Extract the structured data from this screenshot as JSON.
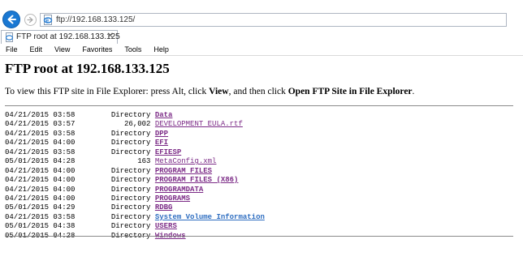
{
  "browser": {
    "address": "ftp://192.168.133.125/",
    "tab_title": "FTP root at 192.168.133.125",
    "tab_close": "✕",
    "menu": [
      "File",
      "Edit",
      "View",
      "Favorites",
      "Tools",
      "Help"
    ]
  },
  "page": {
    "title": "FTP root at 192.168.133.125",
    "instruction_before": "To view this FTP site in File Explorer: press Alt, click ",
    "instruction_view": "View",
    "instruction_middle": ", and then click ",
    "instruction_open": "Open FTP Site in File Explorer",
    "instruction_after": "."
  },
  "listing": [
    {
      "date": "04/21/2015",
      "time": "03:58",
      "info": "Directory",
      "name": "Data",
      "type": "dir"
    },
    {
      "date": "04/21/2015",
      "time": "03:57",
      "info": "26,002",
      "name": "DEVELOPMENT EULA.rtf",
      "type": "file"
    },
    {
      "date": "04/21/2015",
      "time": "03:58",
      "info": "Directory",
      "name": "DPP",
      "type": "dir"
    },
    {
      "date": "04/21/2015",
      "time": "04:00",
      "info": "Directory",
      "name": "EFI",
      "type": "dir"
    },
    {
      "date": "04/21/2015",
      "time": "03:58",
      "info": "Directory",
      "name": "EFIESP",
      "type": "dir"
    },
    {
      "date": "05/01/2015",
      "time": "04:28",
      "info": "163",
      "name": "MetaConfig.xml",
      "type": "file"
    },
    {
      "date": "04/21/2015",
      "time": "04:00",
      "info": "Directory",
      "name": "PROGRAM FILES",
      "type": "dir"
    },
    {
      "date": "04/21/2015",
      "time": "04:00",
      "info": "Directory",
      "name": "PROGRAM FILES (X86)",
      "type": "dir"
    },
    {
      "date": "04/21/2015",
      "time": "04:00",
      "info": "Directory",
      "name": "PROGRAMDATA",
      "type": "dir"
    },
    {
      "date": "04/21/2015",
      "time": "04:00",
      "info": "Directory",
      "name": "PROGRAMS",
      "type": "dir"
    },
    {
      "date": "05/01/2015",
      "time": "04:29",
      "info": "Directory",
      "name": "RDBG",
      "type": "dir"
    },
    {
      "date": "04/21/2015",
      "time": "03:58",
      "info": "Directory",
      "name": "System Volume Information",
      "type": "dir-blue"
    },
    {
      "date": "05/01/2015",
      "time": "04:38",
      "info": "Directory",
      "name": "USERS",
      "type": "dir"
    },
    {
      "date": "05/01/2015",
      "time": "04:28",
      "info": "Directory",
      "name": "Windows",
      "type": "dir"
    }
  ],
  "colors": {
    "visited_link": "#7b2a86",
    "link": "#2c6cc0",
    "back_button": "#1a78d2"
  },
  "icons": [
    "back-arrow-icon",
    "forward-arrow-icon",
    "ie-page-icon",
    "tab-page-icon"
  ]
}
